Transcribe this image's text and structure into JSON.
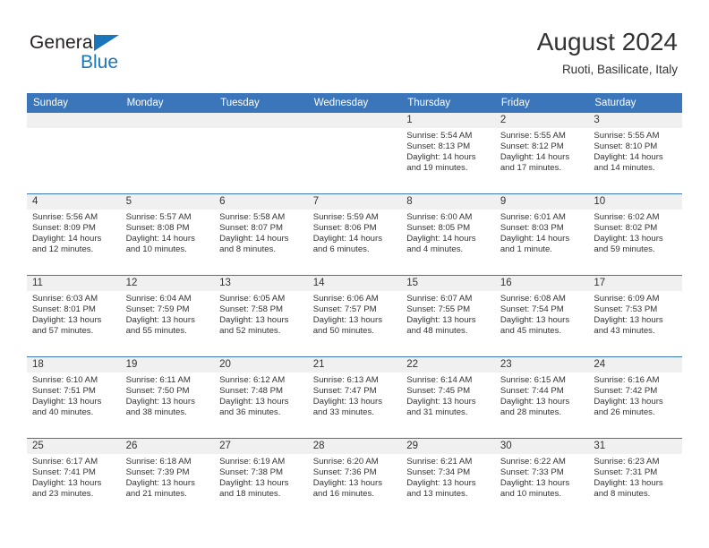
{
  "brand": {
    "name_part1": "General",
    "name_part2": "Blue",
    "color_primary": "#1b75bb",
    "color_text": "#231f20"
  },
  "header": {
    "month_title": "August 2024",
    "location": "Ruoti, Basilicate, Italy"
  },
  "theme": {
    "header_row_bg": "#3b76ba",
    "date_band_bg": "#f0f0f0",
    "text_color": "#333333"
  },
  "weekday_headers": [
    "Sunday",
    "Monday",
    "Tuesday",
    "Wednesday",
    "Thursday",
    "Friday",
    "Saturday"
  ],
  "weeks": [
    [
      {
        "day": "",
        "empty": true,
        "sunrise": "",
        "sunset": "",
        "daylight_line1": "",
        "daylight_line2": ""
      },
      {
        "day": "",
        "empty": true,
        "sunrise": "",
        "sunset": "",
        "daylight_line1": "",
        "daylight_line2": ""
      },
      {
        "day": "",
        "empty": true,
        "sunrise": "",
        "sunset": "",
        "daylight_line1": "",
        "daylight_line2": ""
      },
      {
        "day": "",
        "empty": true,
        "sunrise": "",
        "sunset": "",
        "daylight_line1": "",
        "daylight_line2": ""
      },
      {
        "day": "1",
        "empty": false,
        "sunrise": "Sunrise: 5:54 AM",
        "sunset": "Sunset: 8:13 PM",
        "daylight_line1": "Daylight: 14 hours",
        "daylight_line2": "and 19 minutes."
      },
      {
        "day": "2",
        "empty": false,
        "sunrise": "Sunrise: 5:55 AM",
        "sunset": "Sunset: 8:12 PM",
        "daylight_line1": "Daylight: 14 hours",
        "daylight_line2": "and 17 minutes."
      },
      {
        "day": "3",
        "empty": false,
        "sunrise": "Sunrise: 5:55 AM",
        "sunset": "Sunset: 8:10 PM",
        "daylight_line1": "Daylight: 14 hours",
        "daylight_line2": "and 14 minutes."
      }
    ],
    [
      {
        "day": "4",
        "empty": false,
        "sunrise": "Sunrise: 5:56 AM",
        "sunset": "Sunset: 8:09 PM",
        "daylight_line1": "Daylight: 14 hours",
        "daylight_line2": "and 12 minutes."
      },
      {
        "day": "5",
        "empty": false,
        "sunrise": "Sunrise: 5:57 AM",
        "sunset": "Sunset: 8:08 PM",
        "daylight_line1": "Daylight: 14 hours",
        "daylight_line2": "and 10 minutes."
      },
      {
        "day": "6",
        "empty": false,
        "sunrise": "Sunrise: 5:58 AM",
        "sunset": "Sunset: 8:07 PM",
        "daylight_line1": "Daylight: 14 hours",
        "daylight_line2": "and 8 minutes."
      },
      {
        "day": "7",
        "empty": false,
        "sunrise": "Sunrise: 5:59 AM",
        "sunset": "Sunset: 8:06 PM",
        "daylight_line1": "Daylight: 14 hours",
        "daylight_line2": "and 6 minutes."
      },
      {
        "day": "8",
        "empty": false,
        "sunrise": "Sunrise: 6:00 AM",
        "sunset": "Sunset: 8:05 PM",
        "daylight_line1": "Daylight: 14 hours",
        "daylight_line2": "and 4 minutes."
      },
      {
        "day": "9",
        "empty": false,
        "sunrise": "Sunrise: 6:01 AM",
        "sunset": "Sunset: 8:03 PM",
        "daylight_line1": "Daylight: 14 hours",
        "daylight_line2": "and 1 minute."
      },
      {
        "day": "10",
        "empty": false,
        "sunrise": "Sunrise: 6:02 AM",
        "sunset": "Sunset: 8:02 PM",
        "daylight_line1": "Daylight: 13 hours",
        "daylight_line2": "and 59 minutes."
      }
    ],
    [
      {
        "day": "11",
        "empty": false,
        "sunrise": "Sunrise: 6:03 AM",
        "sunset": "Sunset: 8:01 PM",
        "daylight_line1": "Daylight: 13 hours",
        "daylight_line2": "and 57 minutes."
      },
      {
        "day": "12",
        "empty": false,
        "sunrise": "Sunrise: 6:04 AM",
        "sunset": "Sunset: 7:59 PM",
        "daylight_line1": "Daylight: 13 hours",
        "daylight_line2": "and 55 minutes."
      },
      {
        "day": "13",
        "empty": false,
        "sunrise": "Sunrise: 6:05 AM",
        "sunset": "Sunset: 7:58 PM",
        "daylight_line1": "Daylight: 13 hours",
        "daylight_line2": "and 52 minutes."
      },
      {
        "day": "14",
        "empty": false,
        "sunrise": "Sunrise: 6:06 AM",
        "sunset": "Sunset: 7:57 PM",
        "daylight_line1": "Daylight: 13 hours",
        "daylight_line2": "and 50 minutes."
      },
      {
        "day": "15",
        "empty": false,
        "sunrise": "Sunrise: 6:07 AM",
        "sunset": "Sunset: 7:55 PM",
        "daylight_line1": "Daylight: 13 hours",
        "daylight_line2": "and 48 minutes."
      },
      {
        "day": "16",
        "empty": false,
        "sunrise": "Sunrise: 6:08 AM",
        "sunset": "Sunset: 7:54 PM",
        "daylight_line1": "Daylight: 13 hours",
        "daylight_line2": "and 45 minutes."
      },
      {
        "day": "17",
        "empty": false,
        "sunrise": "Sunrise: 6:09 AM",
        "sunset": "Sunset: 7:53 PM",
        "daylight_line1": "Daylight: 13 hours",
        "daylight_line2": "and 43 minutes."
      }
    ],
    [
      {
        "day": "18",
        "empty": false,
        "sunrise": "Sunrise: 6:10 AM",
        "sunset": "Sunset: 7:51 PM",
        "daylight_line1": "Daylight: 13 hours",
        "daylight_line2": "and 40 minutes."
      },
      {
        "day": "19",
        "empty": false,
        "sunrise": "Sunrise: 6:11 AM",
        "sunset": "Sunset: 7:50 PM",
        "daylight_line1": "Daylight: 13 hours",
        "daylight_line2": "and 38 minutes."
      },
      {
        "day": "20",
        "empty": false,
        "sunrise": "Sunrise: 6:12 AM",
        "sunset": "Sunset: 7:48 PM",
        "daylight_line1": "Daylight: 13 hours",
        "daylight_line2": "and 36 minutes."
      },
      {
        "day": "21",
        "empty": false,
        "sunrise": "Sunrise: 6:13 AM",
        "sunset": "Sunset: 7:47 PM",
        "daylight_line1": "Daylight: 13 hours",
        "daylight_line2": "and 33 minutes."
      },
      {
        "day": "22",
        "empty": false,
        "sunrise": "Sunrise: 6:14 AM",
        "sunset": "Sunset: 7:45 PM",
        "daylight_line1": "Daylight: 13 hours",
        "daylight_line2": "and 31 minutes."
      },
      {
        "day": "23",
        "empty": false,
        "sunrise": "Sunrise: 6:15 AM",
        "sunset": "Sunset: 7:44 PM",
        "daylight_line1": "Daylight: 13 hours",
        "daylight_line2": "and 28 minutes."
      },
      {
        "day": "24",
        "empty": false,
        "sunrise": "Sunrise: 6:16 AM",
        "sunset": "Sunset: 7:42 PM",
        "daylight_line1": "Daylight: 13 hours",
        "daylight_line2": "and 26 minutes."
      }
    ],
    [
      {
        "day": "25",
        "empty": false,
        "sunrise": "Sunrise: 6:17 AM",
        "sunset": "Sunset: 7:41 PM",
        "daylight_line1": "Daylight: 13 hours",
        "daylight_line2": "and 23 minutes."
      },
      {
        "day": "26",
        "empty": false,
        "sunrise": "Sunrise: 6:18 AM",
        "sunset": "Sunset: 7:39 PM",
        "daylight_line1": "Daylight: 13 hours",
        "daylight_line2": "and 21 minutes."
      },
      {
        "day": "27",
        "empty": false,
        "sunrise": "Sunrise: 6:19 AM",
        "sunset": "Sunset: 7:38 PM",
        "daylight_line1": "Daylight: 13 hours",
        "daylight_line2": "and 18 minutes."
      },
      {
        "day": "28",
        "empty": false,
        "sunrise": "Sunrise: 6:20 AM",
        "sunset": "Sunset: 7:36 PM",
        "daylight_line1": "Daylight: 13 hours",
        "daylight_line2": "and 16 minutes."
      },
      {
        "day": "29",
        "empty": false,
        "sunrise": "Sunrise: 6:21 AM",
        "sunset": "Sunset: 7:34 PM",
        "daylight_line1": "Daylight: 13 hours",
        "daylight_line2": "and 13 minutes."
      },
      {
        "day": "30",
        "empty": false,
        "sunrise": "Sunrise: 6:22 AM",
        "sunset": "Sunset: 7:33 PM",
        "daylight_line1": "Daylight: 13 hours",
        "daylight_line2": "and 10 minutes."
      },
      {
        "day": "31",
        "empty": false,
        "sunrise": "Sunrise: 6:23 AM",
        "sunset": "Sunset: 7:31 PM",
        "daylight_line1": "Daylight: 13 hours",
        "daylight_line2": "and 8 minutes."
      }
    ]
  ]
}
